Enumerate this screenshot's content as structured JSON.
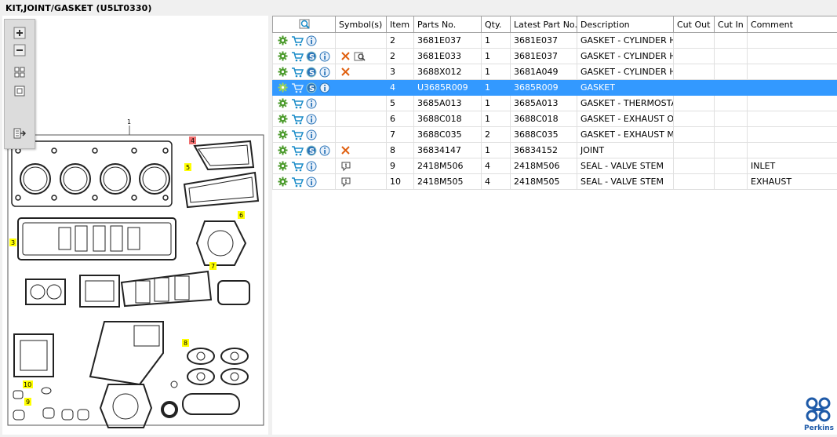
{
  "window": {
    "title": "KIT,JOINT/GASKET (U5LT0330)"
  },
  "diagram": {
    "callouts": {
      "c1": "1",
      "c3": "3",
      "c4": "4",
      "c5": "5",
      "c6": "6",
      "c7": "7",
      "c8": "8",
      "c9": "9",
      "c10": "10"
    },
    "tools": [
      "zoom-in-icon",
      "zoom-out-icon",
      "fit-icon",
      "actual-size-icon",
      "export-icon"
    ]
  },
  "table": {
    "headers": {
      "symbols": "Symbol(s)",
      "item": "Item",
      "parts_no": "Parts No.",
      "qty": "Qty.",
      "latest": "Latest Part No.",
      "description": "Description",
      "cut_out": "Cut Out",
      "cut_in": "Cut In",
      "comment": "Comment"
    },
    "rows": [
      {
        "item": "2",
        "parts_no": "3681E037",
        "qty": "1",
        "latest": "3681E037",
        "description": "GASKET - CYLINDER HEAD",
        "comment": ""
      },
      {
        "item": "2",
        "parts_no": "3681E033",
        "qty": "1",
        "latest": "3681E037",
        "description": "GASKET - CYLINDER HEAD",
        "comment": ""
      },
      {
        "item": "3",
        "parts_no": "3688X012",
        "qty": "1",
        "latest": "3681A049",
        "description": "GASKET - CYLINDER HEAD",
        "comment": ""
      },
      {
        "item": "4",
        "parts_no": "U3685R009",
        "qty": "1",
        "latest": "3685R009",
        "description": "GASKET",
        "comment": ""
      },
      {
        "item": "5",
        "parts_no": "3685A013",
        "qty": "1",
        "latest": "3685A013",
        "description": "GASKET - THERMOSTAT",
        "comment": ""
      },
      {
        "item": "6",
        "parts_no": "3688C018",
        "qty": "1",
        "latest": "3688C018",
        "description": "GASKET - EXHAUST OUTLET",
        "comment": ""
      },
      {
        "item": "7",
        "parts_no": "3688C035",
        "qty": "2",
        "latest": "3688C035",
        "description": "GASKET - EXHAUST MANIFOLD",
        "comment": ""
      },
      {
        "item": "8",
        "parts_no": "36834147",
        "qty": "1",
        "latest": "36834152",
        "description": "JOINT",
        "comment": ""
      },
      {
        "item": "9",
        "parts_no": "2418M506",
        "qty": "4",
        "latest": "2418M506",
        "description": "SEAL - VALVE STEM",
        "comment": "INLET"
      },
      {
        "item": "10",
        "parts_no": "2418M505",
        "qty": "4",
        "latest": "2418M505",
        "description": "SEAL - VALVE STEM",
        "comment": "EXHAUST"
      }
    ]
  },
  "brand": {
    "name": "Perkins",
    "color": "#1e5aa8"
  },
  "colors": {
    "selection": "#3399ff",
    "cart": "#1a8cc8",
    "gear": "#4a9a2a",
    "cross": "#e06010",
    "callout_yellow": "#ffff00",
    "callout_red": "#f07070"
  }
}
